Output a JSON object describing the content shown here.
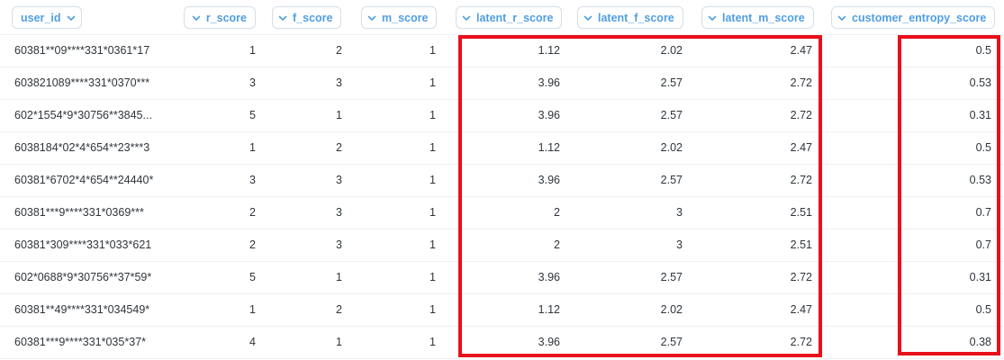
{
  "columns": [
    {
      "key": "user_id",
      "label": "user_id"
    },
    {
      "key": "r_score",
      "label": "r_score"
    },
    {
      "key": "f_score",
      "label": "f_score"
    },
    {
      "key": "m_score",
      "label": "m_score"
    },
    {
      "key": "latent_r_score",
      "label": "latent_r_score"
    },
    {
      "key": "latent_f_score",
      "label": "latent_f_score"
    },
    {
      "key": "latent_m_score",
      "label": "latent_m_score"
    },
    {
      "key": "customer_entropy_score",
      "label": "customer_entropy_score"
    }
  ],
  "rows": [
    [
      "60381**09****331*0361*17",
      "1",
      "2",
      "1",
      "1.12",
      "2.02",
      "2.47",
      "0.5"
    ],
    [
      "603821089****331*0370***",
      "3",
      "3",
      "1",
      "3.96",
      "2.57",
      "2.72",
      "0.53"
    ],
    [
      "602*1554*9*30756**3845...",
      "5",
      "1",
      "1",
      "3.96",
      "2.57",
      "2.72",
      "0.31"
    ],
    [
      "6038184*02*4*654**23***3",
      "1",
      "2",
      "1",
      "1.12",
      "2.02",
      "2.47",
      "0.5"
    ],
    [
      "60381*6702*4*654**24440*",
      "3",
      "3",
      "1",
      "3.96",
      "2.57",
      "2.72",
      "0.53"
    ],
    [
      "60381***9****331*0369***",
      "2",
      "3",
      "1",
      "2",
      "3",
      "2.51",
      "0.7"
    ],
    [
      "60381*309****331*033*621",
      "2",
      "3",
      "1",
      "2",
      "3",
      "2.51",
      "0.7"
    ],
    [
      "602*0688*9*30756**37*59*",
      "5",
      "1",
      "1",
      "3.96",
      "2.57",
      "2.72",
      "0.31"
    ],
    [
      "60381**49****331*034549*",
      "1",
      "2",
      "1",
      "1.12",
      "2.02",
      "2.47",
      "0.5"
    ],
    [
      "60381***9****331*035*37*",
      "4",
      "1",
      "1",
      "3.96",
      "2.57",
      "2.72",
      "0.38"
    ]
  ],
  "colors": {
    "accent": "#509ee3",
    "highlight": "#e8101a",
    "text": "#2e353b",
    "border": "#eef0f2"
  },
  "icons": {
    "header_dropdown": "chevron-down-icon"
  }
}
